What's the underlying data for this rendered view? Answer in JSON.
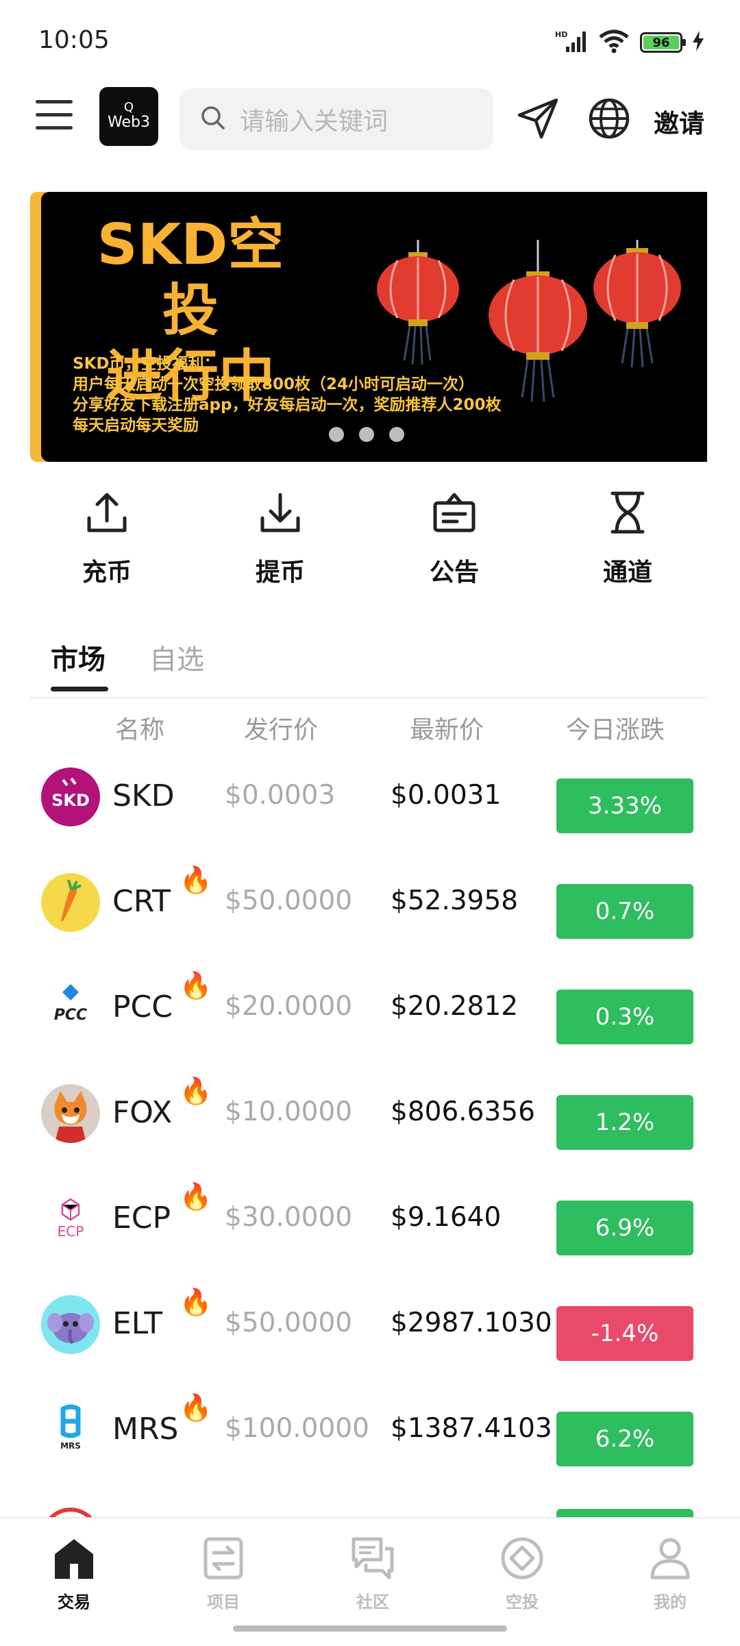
{
  "status_bar": {
    "time": "10:05",
    "battery": "96",
    "network": "HD"
  },
  "header": {
    "logo_top": "Q",
    "logo_text": "Web3",
    "search_placeholder": "请输入关键词",
    "invite_label": "邀请"
  },
  "banner": {
    "title_line1": "SKD空投",
    "title_line2": "进行中",
    "desc": [
      "SKD币，空投福利：",
      "用户每天启动一次空投领取800枚（24小时可启动一次）",
      "分享好友下载注册app，好友每启动一次，奖励推荐人200枚",
      "每天启动每天奖励"
    ]
  },
  "quick_actions": [
    {
      "label": "充币",
      "icon": "upload-icon"
    },
    {
      "label": "提币",
      "icon": "download-icon"
    },
    {
      "label": "公告",
      "icon": "announcement-icon"
    },
    {
      "label": "通道",
      "icon": "hourglass-icon"
    }
  ],
  "tabs": {
    "market": "市场",
    "favorites": "自选"
  },
  "columns": {
    "name": "名称",
    "issue_price": "发行价",
    "latest_price": "最新价",
    "change": "今日涨跌"
  },
  "colors": {
    "up": "#2ebd5f",
    "down": "#ea4a6a",
    "accent": "#f4b73a"
  },
  "coins": [
    {
      "symbol": "SKD",
      "hot": false,
      "issue_price": "$0.0003",
      "latest_price": "$0.0031",
      "change": "3.33%",
      "direction": "up"
    },
    {
      "symbol": "CRT",
      "hot": true,
      "issue_price": "$50.0000",
      "latest_price": "$52.3958",
      "change": "0.7%",
      "direction": "up"
    },
    {
      "symbol": "PCC",
      "hot": true,
      "issue_price": "$20.0000",
      "latest_price": "$20.2812",
      "change": "0.3%",
      "direction": "up"
    },
    {
      "symbol": "FOX",
      "hot": true,
      "issue_price": "$10.0000",
      "latest_price": "$806.6356",
      "change": "1.2%",
      "direction": "up"
    },
    {
      "symbol": "ECP",
      "hot": true,
      "issue_price": "$30.0000",
      "latest_price": "$9.1640",
      "change": "6.9%",
      "direction": "up"
    },
    {
      "symbol": "ELT",
      "hot": true,
      "issue_price": "$50.0000",
      "latest_price": "$2987.1030",
      "change": "-1.4%",
      "direction": "down"
    },
    {
      "symbol": "MRS",
      "hot": true,
      "issue_price": "$100.0000",
      "latest_price": "$1387.4103",
      "change": "6.2%",
      "direction": "up"
    }
  ],
  "icon_labels": {
    "skd": "SKD",
    "pcc": "PCC",
    "ecp": "ECP",
    "mrs": "MRS"
  },
  "fire_glyph": "🔥",
  "bottom_nav": [
    {
      "label": "交易",
      "active": true
    },
    {
      "label": "项目",
      "active": false
    },
    {
      "label": "社区",
      "active": false
    },
    {
      "label": "空投",
      "active": false
    },
    {
      "label": "我的",
      "active": false
    }
  ]
}
